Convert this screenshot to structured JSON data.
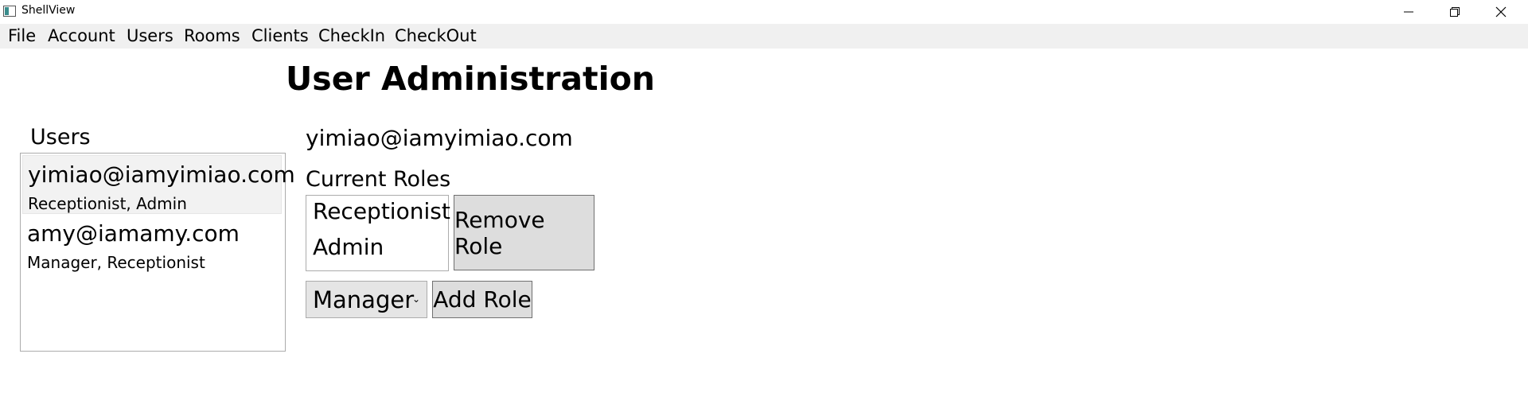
{
  "window": {
    "title": "ShellView"
  },
  "menu": {
    "items": [
      "File",
      "Account",
      "Users",
      "Rooms",
      "Clients",
      "CheckIn",
      "CheckOut"
    ]
  },
  "page": {
    "title": "User Administration"
  },
  "users_panel": {
    "label": "Users",
    "users": [
      {
        "email": "yimiao@iamyimiao.com",
        "roles": "Receptionist, Admin",
        "selected": true
      },
      {
        "email": "amy@iamamy.com",
        "roles": "Manager, Receptionist",
        "selected": false
      }
    ]
  },
  "detail": {
    "selected_email": "yimiao@iamyimiao.com",
    "current_roles_label": "Current Roles",
    "current_roles": [
      "Receptionist",
      "Admin"
    ],
    "remove_role_label": "Remove Role",
    "role_dropdown_value": "Manager",
    "add_role_label": "Add Role"
  },
  "icons": {
    "minimize": "minimize-icon",
    "maximize": "restore-icon",
    "close": "close-icon",
    "dropdown": "chevron-down-icon"
  }
}
